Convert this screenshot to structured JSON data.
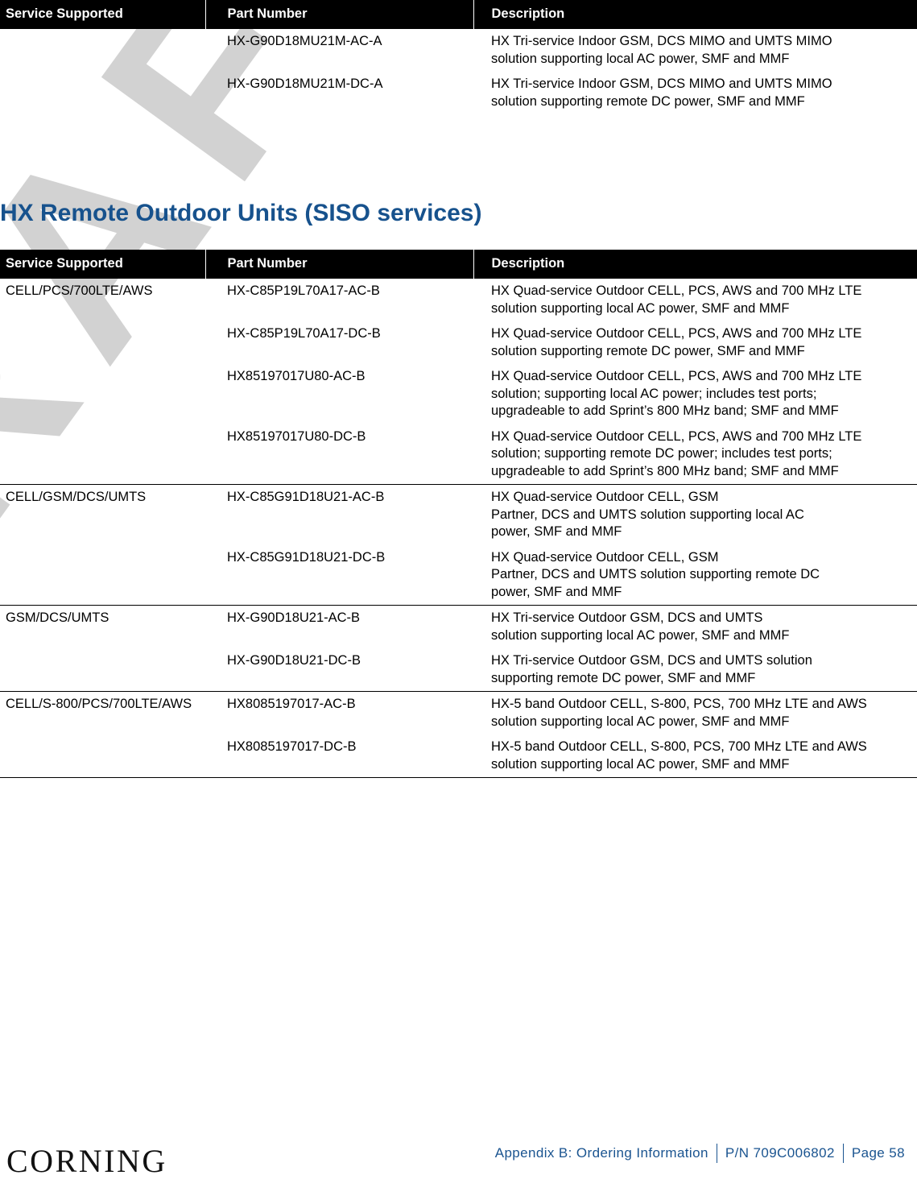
{
  "watermark": {
    "text": "DRAFT",
    "color": "#d2d2d2"
  },
  "tables": {
    "columns": {
      "service": "Service Supported",
      "part": "Part Number",
      "description": "Description"
    },
    "indoor_continued": {
      "rows": [
        {
          "service": "",
          "part": "HX-G90D18MU21M-AC-A",
          "description": "HX Tri-service Indoor GSM, DCS MIMO and UMTS MIMO solution supporting local AC power, SMF and MMF"
        },
        {
          "service": "",
          "part": "HX-G90D18MU21M-DC-A",
          "description": "HX Tri-service Indoor GSM, DCS MIMO and UMTS MIMO solution supporting remote DC power, SMF and MMF"
        }
      ]
    },
    "outdoor_siso": {
      "heading": "HX Remote Outdoor Units (SISO services)",
      "rows": [
        {
          "service": "CELL/PCS/700LTE/AWS",
          "part": "HX-C85P19L70A17-AC-B",
          "description": "HX Quad-service Outdoor CELL, PCS, AWS and 700 MHz LTE solution supporting local AC power, SMF and MMF",
          "group_start": true
        },
        {
          "service": "",
          "part": "HX-C85P19L70A17-DC-B",
          "description": "HX Quad-service Outdoor CELL, PCS, AWS and 700 MHz LTE solution supporting remote DC power, SMF and MMF",
          "group_start": false
        },
        {
          "service": "",
          "part": "HX85197017U80-AC-B",
          "description": "HX Quad-service Outdoor CELL, PCS, AWS and 700 MHz LTE solution; supporting local AC power; includes test ports; upgradeable to add Sprint’s 800 MHz band; SMF and MMF",
          "group_start": false
        },
        {
          "service": "",
          "part": "HX85197017U80-DC-B",
          "description": "HX Quad-service Outdoor CELL, PCS, AWS and 700 MHz LTE solution; supporting remote DC power; includes test ports; upgradeable to add Sprint’s 800 MHz band; SMF and MMF",
          "group_start": false
        },
        {
          "service": "CELL/GSM/DCS/UMTS",
          "part": "HX-C85G91D18U21-AC-B",
          "description_lines": [
            " HX Quad-service Outdoor CELL, GSM",
            " Partner, DCS and UMTS solution supporting local AC",
            "power, SMF and MMF"
          ],
          "group_start": true
        },
        {
          "service": "",
          "part": "HX-C85G91D18U21-DC-B",
          "description_lines": [
            " HX Quad-service Outdoor CELL, GSM",
            " Partner, DCS and UMTS solution supporting remote DC",
            "power, SMF and MMF"
          ],
          "group_start": false
        },
        {
          "service": "GSM/DCS/UMTS",
          "part": "HX-G90D18U21-AC-B",
          "description_lines": [
            " HX Tri-service Outdoor GSM, DCS and UMTS",
            "solution supporting local AC power, SMF and MMF"
          ],
          "group_start": true
        },
        {
          "service": "",
          "part": "HX-G90D18U21-DC-B",
          "description": "HX Tri-service Outdoor GSM, DCS and UMTS solution supporting remote DC power, SMF and MMF",
          "group_start": false
        },
        {
          "service": "CELL/S-800/PCS/700LTE/AWS",
          "part": "HX8085197017-AC-B",
          "description": "HX-5 band Outdoor CELL, S-800, PCS, 700 MHz LTE and AWS solution supporting local AC power, SMF and MMF",
          "group_start": true
        },
        {
          "service": "",
          "part": "HX8085197017-DC-B",
          "description": "HX-5 band Outdoor CELL, S-800, PCS, 700 MHz LTE and AWS solution supporting local AC power, SMF and MMF",
          "group_start": false
        }
      ]
    }
  },
  "footer": {
    "logo": "CORNING",
    "appendix": "Appendix B: Ordering Information",
    "part_number": "P/N 709C006802",
    "page": "Page 58",
    "link_color": "#1a5490"
  }
}
